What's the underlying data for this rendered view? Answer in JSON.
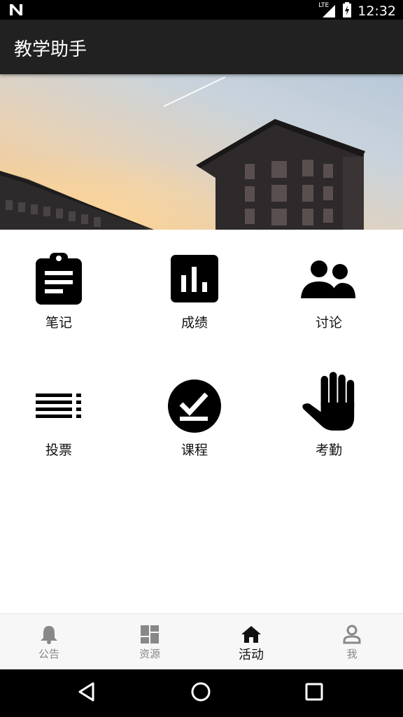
{
  "status_bar": {
    "network": "LTE",
    "time": "12:32"
  },
  "app_bar": {
    "title": "教学助手"
  },
  "grid": [
    {
      "label": "笔记",
      "icon": "clipboard-icon"
    },
    {
      "label": "成绩",
      "icon": "bar-chart-icon"
    },
    {
      "label": "讨论",
      "icon": "people-icon"
    },
    {
      "label": "投票",
      "icon": "list-icon"
    },
    {
      "label": "课程",
      "icon": "check-circle-icon"
    },
    {
      "label": "考勤",
      "icon": "hand-icon"
    }
  ],
  "bottom_nav": [
    {
      "label": "公告",
      "icon": "bell-icon",
      "active": false
    },
    {
      "label": "资源",
      "icon": "dashboard-icon",
      "active": false
    },
    {
      "label": "活动",
      "icon": "home-icon",
      "active": true
    },
    {
      "label": "我",
      "icon": "person-icon",
      "active": false
    }
  ],
  "colors": {
    "app_bar": "#212121",
    "status_bar": "#000000",
    "active_nav": "#111111",
    "inactive_nav": "#888888"
  }
}
